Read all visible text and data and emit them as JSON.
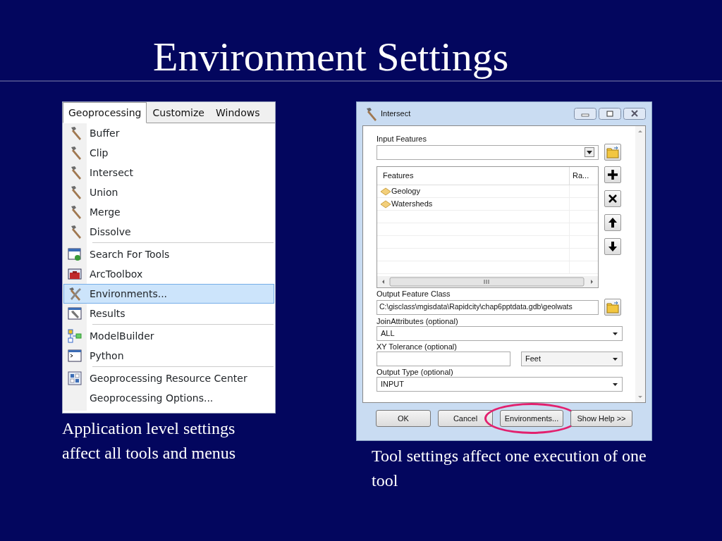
{
  "slide": {
    "title": "Environment Settings"
  },
  "menu": {
    "tabs": [
      {
        "label": "Geoprocessing",
        "selected": true
      },
      {
        "label": "Customize",
        "selected": false
      },
      {
        "label": "Windows",
        "selected": false
      }
    ],
    "groups": [
      [
        {
          "label": "Buffer",
          "kind": "hammer",
          "selected": false
        },
        {
          "label": "Clip",
          "kind": "hammer",
          "selected": false
        },
        {
          "label": "Intersect",
          "kind": "hammer",
          "selected": false
        },
        {
          "label": "Union",
          "kind": "hammer",
          "selected": false
        },
        {
          "label": "Merge",
          "kind": "hammer",
          "selected": false
        },
        {
          "label": "Dissolve",
          "kind": "hammer",
          "selected": false
        }
      ],
      [
        {
          "label": "Search For Tools",
          "kind": "search",
          "selected": false
        },
        {
          "label": "ArcToolbox",
          "kind": "toolbox",
          "selected": false
        },
        {
          "label": "Environments...",
          "kind": "tools",
          "selected": true
        },
        {
          "label": "Results",
          "kind": "results",
          "selected": false
        }
      ],
      [
        {
          "label": "ModelBuilder",
          "kind": "model",
          "selected": false
        },
        {
          "label": "Python",
          "kind": "python",
          "selected": false
        }
      ],
      [
        {
          "label": "Geoprocessing Resource Center",
          "kind": "resource",
          "selected": false
        },
        {
          "label": "Geoprocessing Options...",
          "kind": "none",
          "selected": false
        }
      ]
    ]
  },
  "menu_caption": "Application level settings affect all tools and menus",
  "dialog": {
    "title": "Intersect",
    "input_features": {
      "label": "Input Features"
    },
    "features_table": {
      "columns": [
        "Features",
        "Ra..."
      ],
      "rows": [
        {
          "name": "Geology"
        },
        {
          "name": "Watersheds"
        }
      ]
    },
    "output_feature_class": {
      "label": "Output Feature Class",
      "value": "C:\\gisclass\\mgisdata\\Rapidcity\\chap6pptdata.gdb\\geolwats"
    },
    "join_attributes": {
      "label": "JoinAttributes (optional)",
      "value": "ALL"
    },
    "xy_tolerance": {
      "label": "XY Tolerance (optional)",
      "unit": "Feet"
    },
    "output_type": {
      "label": "Output Type (optional)",
      "value": "INPUT"
    },
    "buttons": [
      {
        "label": "OK",
        "highlighted": false
      },
      {
        "label": "Cancel",
        "highlighted": false
      },
      {
        "label": "Environments...",
        "highlighted": true
      },
      {
        "label": "Show Help >>",
        "highlighted": false
      }
    ]
  },
  "dialog_caption": "Tool settings affect one execution of one tool"
}
